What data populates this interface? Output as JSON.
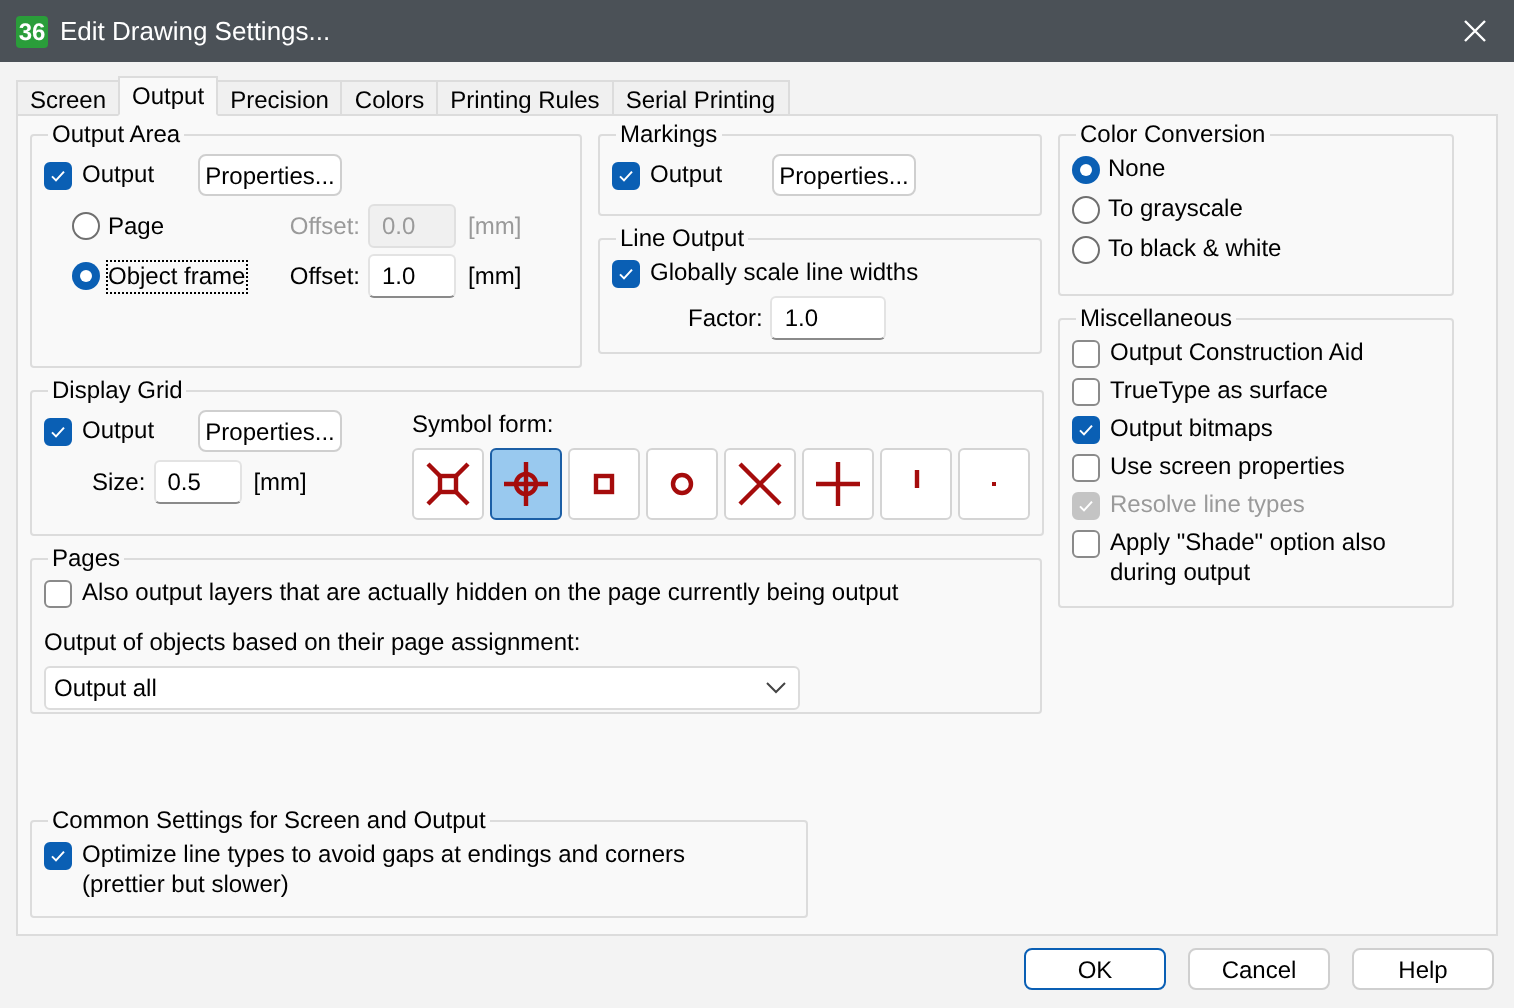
{
  "window": {
    "icon_label": "36",
    "title": "Edit Drawing Settings..."
  },
  "tabs": [
    {
      "label": "Screen",
      "selected": false
    },
    {
      "label": "Output",
      "selected": true
    },
    {
      "label": "Precision",
      "selected": false
    },
    {
      "label": "Colors",
      "selected": false
    },
    {
      "label": "Printing Rules",
      "selected": false
    },
    {
      "label": "Serial Printing",
      "selected": false
    }
  ],
  "output_area": {
    "title": "Output Area",
    "output": {
      "label": "Output",
      "checked": true
    },
    "properties_button": "Properties...",
    "options": [
      {
        "label": "Page",
        "selected": false,
        "focused": false,
        "offset_label": "Offset:",
        "offset_value": "0.0",
        "unit": "[mm]",
        "disabled": true
      },
      {
        "label": "Object frame",
        "selected": true,
        "focused": true,
        "offset_label": "Offset:",
        "offset_value": "1.0",
        "unit": "[mm]",
        "disabled": false
      }
    ]
  },
  "markings": {
    "title": "Markings",
    "output": {
      "label": "Output",
      "checked": true
    },
    "properties_button": "Properties..."
  },
  "line_output": {
    "title": "Line Output",
    "scale": {
      "label": "Globally scale line widths",
      "checked": true
    },
    "factor_label": "Factor:",
    "factor_value": "1.0"
  },
  "display_grid": {
    "title": "Display Grid",
    "output": {
      "label": "Output",
      "checked": true
    },
    "properties_button": "Properties...",
    "size_label": "Size:",
    "size_value": "0.5",
    "size_unit": "[mm]",
    "symbol_form_label": "Symbol form:",
    "symbols": [
      {
        "kind": "cornered-square",
        "selected": false
      },
      {
        "kind": "crosshair",
        "selected": true
      },
      {
        "kind": "square",
        "selected": false
      },
      {
        "kind": "circle",
        "selected": false
      },
      {
        "kind": "x",
        "selected": false
      },
      {
        "kind": "plus",
        "selected": false
      },
      {
        "kind": "tick",
        "selected": false
      },
      {
        "kind": "dot",
        "selected": false
      }
    ]
  },
  "pages": {
    "title": "Pages",
    "hidden_layers": {
      "label": "Also output layers that are actually hidden on the page currently being output",
      "checked": false
    },
    "assignment_label": "Output of objects based on their page assignment:",
    "assignment_value": "Output all"
  },
  "common": {
    "title": "Common Settings for Screen and Output",
    "optimize": {
      "label": "Optimize line types to avoid gaps at endings and corners\n(prettier but slower)",
      "checked": true
    }
  },
  "color_conversion": {
    "title": "Color Conversion",
    "options": [
      {
        "label": "None",
        "selected": true
      },
      {
        "label": "To grayscale",
        "selected": false
      },
      {
        "label": "To black & white",
        "selected": false
      }
    ]
  },
  "misc": {
    "title": "Miscellaneous",
    "items": [
      {
        "label": "Output Construction Aid",
        "checked": false,
        "disabled": false
      },
      {
        "label": "TrueType as surface",
        "checked": false,
        "disabled": false
      },
      {
        "label": "Output bitmaps",
        "checked": true,
        "disabled": false
      },
      {
        "label": "Use screen properties",
        "checked": false,
        "disabled": false
      },
      {
        "label": "Resolve line types",
        "checked": true,
        "disabled": true
      },
      {
        "label": "Apply \"Shade\" option also\nduring output",
        "checked": false,
        "disabled": false
      }
    ]
  },
  "buttons": [
    {
      "label": "OK",
      "default": true
    },
    {
      "label": "Cancel",
      "default": false
    },
    {
      "label": "Help",
      "default": false
    }
  ]
}
